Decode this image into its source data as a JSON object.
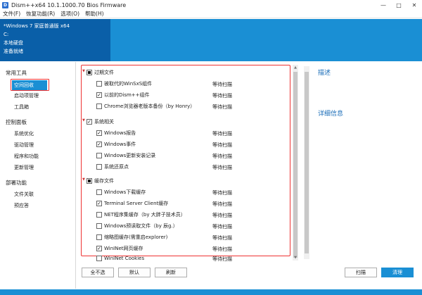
{
  "window": {
    "icon_letter": "D",
    "title": "Dism++x64 10.1.1000.70 Bios Firmware",
    "controls": [
      "—",
      "□",
      "✕"
    ]
  },
  "menu": [
    "文件(F)",
    "恢复功能(R)",
    "选项(O)",
    "帮助(H)"
  ],
  "system": {
    "os": "*Windows 7 家庭普通版 x64",
    "drive": "C:",
    "disk": "本地硬盘",
    "state": "准备就绪"
  },
  "sidebar": {
    "groups": [
      {
        "label": "常用工具",
        "items": [
          "空间回收",
          "启动项管理",
          "工具箱"
        ]
      },
      {
        "label": "控制面板",
        "items": [
          "系统优化",
          "驱动管理",
          "程序和功能",
          "更新管理"
        ]
      },
      {
        "label": "部署功能",
        "items": [
          "文件关联",
          "预应答"
        ]
      }
    ],
    "active": "空间回收"
  },
  "categories": [
    {
      "name": "过期文件",
      "state": "partial",
      "items": [
        {
          "label": "被取代的WinSxS组件",
          "checked": false,
          "status": "等待扫描"
        },
        {
          "label": "以前的Dism++组件",
          "checked": true,
          "status": "等待扫描"
        },
        {
          "label": "Chrome浏览器老版本备份（by Honry）",
          "checked": false,
          "status": "等待扫描"
        }
      ]
    },
    {
      "name": "系统相关",
      "state": "checked",
      "items": [
        {
          "label": "Windows报告",
          "checked": true,
          "status": "等待扫描"
        },
        {
          "label": "Windows事件",
          "checked": true,
          "status": "等待扫描"
        },
        {
          "label": "Windows更新安装记录",
          "checked": false,
          "status": "等待扫描"
        },
        {
          "label": "系统还原点",
          "checked": false,
          "status": "等待扫描"
        }
      ]
    },
    {
      "name": "缓存文件",
      "state": "partial",
      "items": [
        {
          "label": "Windows下载缓存",
          "checked": false,
          "status": "等待扫描"
        },
        {
          "label": "Terminal Server Client缓存",
          "checked": true,
          "status": "等待扫描"
        },
        {
          "label": "NET程序集缓存（by 大胖子技术员）",
          "checked": false,
          "status": "等待扫描"
        },
        {
          "label": "Windows预读取文件（by 辰g.）",
          "checked": false,
          "status": "等待扫描"
        },
        {
          "label": "缩略图缓存(需重启explorer)",
          "checked": false,
          "status": "等待扫描"
        },
        {
          "label": "WinINet网页缓存",
          "checked": true,
          "status": "等待扫描"
        },
        {
          "label": "WinINet Cookies",
          "checked": false,
          "status": "等待扫描"
        }
      ]
    }
  ],
  "buttons": {
    "select_none": "全不选",
    "default": "默认",
    "refresh": "刷新",
    "scan": "扫描",
    "clean": "清理"
  },
  "right_panel": {
    "description": "描述",
    "details": "详细信息"
  },
  "colors": {
    "accent": "#1a8fd4",
    "dark_accent": "#0a5fa8",
    "highlight_box": "#e33333"
  }
}
